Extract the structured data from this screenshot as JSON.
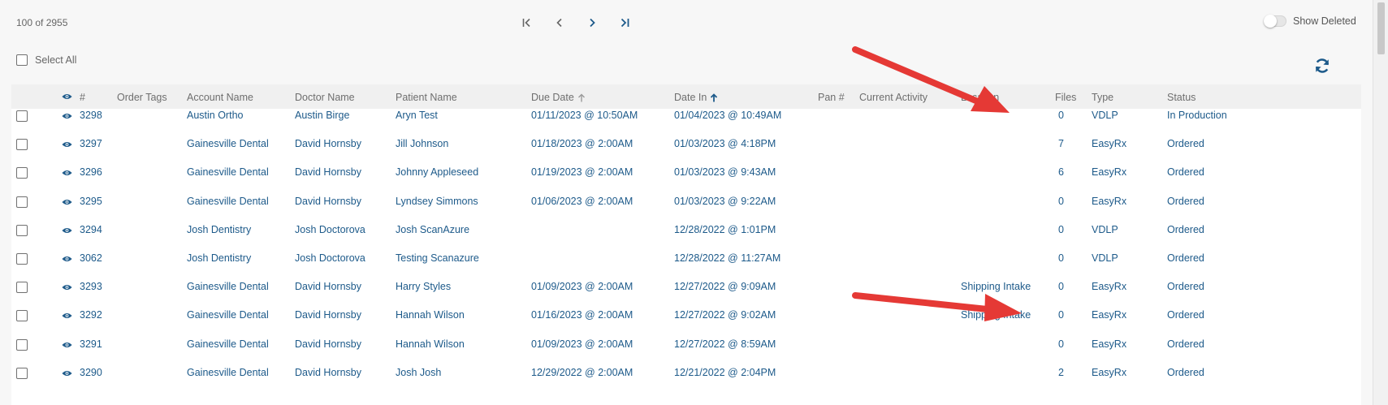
{
  "toolbar": {
    "record_count": "100 of 2955",
    "show_deleted_label": "Show Deleted",
    "select_all_label": "Select All"
  },
  "icons": {
    "first": "first-page-icon",
    "prev": "previous-page-icon",
    "next": "next-page-icon",
    "last": "last-page-icon",
    "refresh": "refresh-icon",
    "view": "eye-icon",
    "sort": "sort-ascending-icon"
  },
  "colors": {
    "accent": "#1d5a8a",
    "header_text": "#6e6e6e",
    "annotation_arrow": "#e53935"
  },
  "table": {
    "columns": {
      "num": "#",
      "order_tags": "Order Tags",
      "account_name": "Account Name",
      "doctor_name": "Doctor Name",
      "patient_name": "Patient Name",
      "due_date": "Due Date",
      "date_in": "Date In",
      "pan": "Pan #",
      "current_activity": "Current Activity",
      "location": "Location",
      "files": "Files",
      "type": "Type",
      "status": "Status"
    },
    "rows": [
      {
        "num": "3298",
        "order_tags": "",
        "account": "Austin Ortho",
        "doctor": "Austin Birge",
        "patient": "Aryn Test",
        "due": "01/11/2023 @ 10:50AM",
        "date_in": "01/04/2023 @ 10:49AM",
        "pan": "",
        "activity": "",
        "location": "",
        "files": "0",
        "type": "VDLP",
        "status": "In Production"
      },
      {
        "num": "3297",
        "order_tags": "",
        "account": "Gainesville Dental",
        "doctor": "David Hornsby",
        "patient": "Jill Johnson",
        "due": "01/18/2023 @ 2:00AM",
        "date_in": "01/03/2023 @ 4:18PM",
        "pan": "",
        "activity": "",
        "location": "",
        "files": "7",
        "type": "EasyRx",
        "status": "Ordered"
      },
      {
        "num": "3296",
        "order_tags": "",
        "account": "Gainesville Dental",
        "doctor": "David Hornsby",
        "patient": "Johnny Appleseed",
        "due": "01/19/2023 @ 2:00AM",
        "date_in": "01/03/2023 @ 9:43AM",
        "pan": "",
        "activity": "",
        "location": "",
        "files": "6",
        "type": "EasyRx",
        "status": "Ordered"
      },
      {
        "num": "3295",
        "order_tags": "",
        "account": "Gainesville Dental",
        "doctor": "David Hornsby",
        "patient": "Lyndsey Simmons",
        "due": "01/06/2023 @ 2:00AM",
        "date_in": "01/03/2023 @ 9:22AM",
        "pan": "",
        "activity": "",
        "location": "",
        "files": "0",
        "type": "EasyRx",
        "status": "Ordered"
      },
      {
        "num": "3294",
        "order_tags": "",
        "account": "Josh Dentistry",
        "doctor": "Josh Doctorova",
        "patient": "Josh ScanAzure",
        "due": "",
        "date_in": "12/28/2022 @ 1:01PM",
        "pan": "",
        "activity": "",
        "location": "",
        "files": "0",
        "type": "VDLP",
        "status": "Ordered"
      },
      {
        "num": "3062",
        "order_tags": "",
        "account": "Josh Dentistry",
        "doctor": "Josh Doctorova",
        "patient": "Testing Scanazure",
        "due": "",
        "date_in": "12/28/2022 @ 11:27AM",
        "pan": "",
        "activity": "",
        "location": "",
        "files": "0",
        "type": "VDLP",
        "status": "Ordered"
      },
      {
        "num": "3293",
        "order_tags": "",
        "account": "Gainesville Dental",
        "doctor": "David Hornsby",
        "patient": "Harry Styles",
        "due": "01/09/2023 @ 2:00AM",
        "date_in": "12/27/2022 @ 9:09AM",
        "pan": "",
        "activity": "",
        "location": "Shipping Intake",
        "files": "0",
        "type": "EasyRx",
        "status": "Ordered"
      },
      {
        "num": "3292",
        "order_tags": "",
        "account": "Gainesville Dental",
        "doctor": "David Hornsby",
        "patient": "Hannah Wilson",
        "due": "01/16/2023 @ 2:00AM",
        "date_in": "12/27/2022 @ 9:02AM",
        "pan": "",
        "activity": "",
        "location": "Shipping Intake",
        "files": "0",
        "type": "EasyRx",
        "status": "Ordered"
      },
      {
        "num": "3291",
        "order_tags": "",
        "account": "Gainesville Dental",
        "doctor": "David Hornsby",
        "patient": "Hannah Wilson",
        "due": "01/09/2023 @ 2:00AM",
        "date_in": "12/27/2022 @ 8:59AM",
        "pan": "",
        "activity": "",
        "location": "",
        "files": "0",
        "type": "EasyRx",
        "status": "Ordered"
      },
      {
        "num": "3290",
        "order_tags": "",
        "account": "Gainesville Dental",
        "doctor": "David Hornsby",
        "patient": "Josh Josh",
        "due": "12/29/2022 @ 2:00AM",
        "date_in": "12/21/2022 @ 2:04PM",
        "pan": "",
        "activity": "",
        "location": "",
        "files": "2",
        "type": "EasyRx",
        "status": "Ordered"
      }
    ]
  }
}
